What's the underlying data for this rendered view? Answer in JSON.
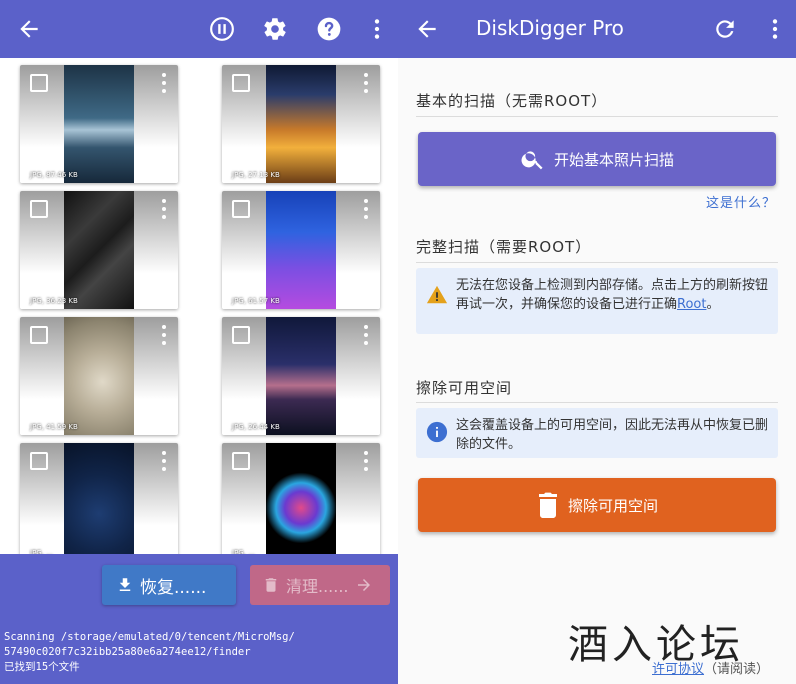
{
  "left": {
    "thumbnails": [
      {
        "label": "JPG, 87.46 KB"
      },
      {
        "label": "JPG, 27.13 KB"
      },
      {
        "label": "JPG, 36.23 KB"
      },
      {
        "label": "JPG, 61.57 KB"
      },
      {
        "label": "JPG, 41.59 KB"
      },
      {
        "label": "JPG, 26.44 KB"
      },
      {
        "label": "JPG, ..."
      },
      {
        "label": "JPG, ..."
      }
    ],
    "recover_label": "恢复......",
    "clean_label": "清理......",
    "status_lines": [
      "Scanning /storage/emulated/0/tencent/MicroMsg/",
      "57490c020f7c32ibb25a80e6a274ee12/finder",
      "已找到15个文件"
    ]
  },
  "right": {
    "title": "DiskDigger Pro",
    "basic_scan_heading": "基本的扫描（无需ROOT）",
    "basic_scan_button": "开始基本照片扫描",
    "what_is_this": "这是什么？",
    "full_scan_heading": "完整扫描（需要ROOT）",
    "full_scan_warning": "无法在您设备上检测到内部存储。点击上方的刷新按钮再试一次，并确保您的设备已进行正确",
    "root_link": "Root",
    "warning_end": "。",
    "wipe_heading": "擦除可用空间",
    "wipe_info": "这会覆盖设备上的可用空间，因此无法再从中恢复已删除的文件。",
    "wipe_button": "擦除可用空间",
    "license_link": "许可协议",
    "license_suffix": "（请阅读）"
  },
  "watermark": "酒入论坛",
  "colors": {
    "toolbar": "#5b61c9",
    "recover_button": "#4079c7",
    "clean_button": "#c06888",
    "scan_button": "#6a64c8",
    "wipe_button": "#e0621f",
    "warning_icon": "#e4a11b",
    "info_icon": "#3d6fd1",
    "link": "#3d6fd1"
  },
  "icons": [
    "back-arrow-icon",
    "pause-icon",
    "gear-icon",
    "help-icon",
    "more-vert-icon",
    "refresh-icon",
    "search-icon",
    "warning-icon",
    "info-icon",
    "trash-icon",
    "download-icon",
    "arrow-right-icon",
    "fullscreen-icon",
    "checkbox-icon"
  ]
}
